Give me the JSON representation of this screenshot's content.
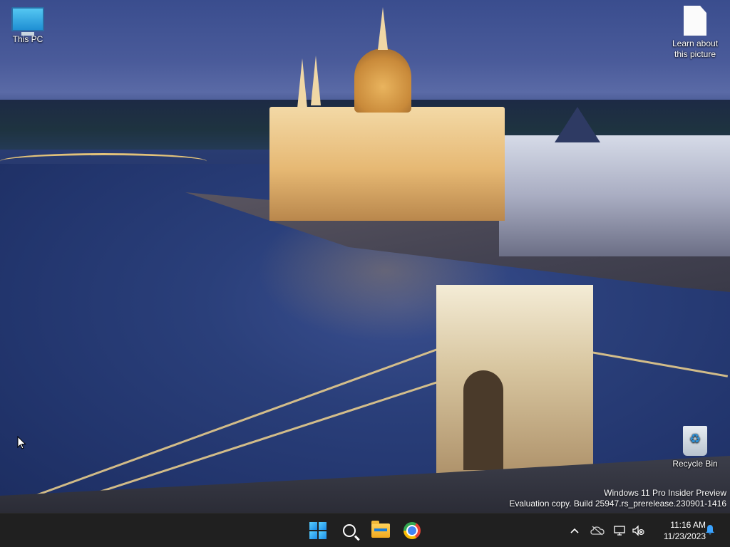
{
  "desktop": {
    "icons": [
      {
        "label": "This PC",
        "icon": "this-pc-icon"
      },
      {
        "label": "Learn about\nthis picture",
        "icon": "document-icon"
      },
      {
        "label": "Recycle Bin",
        "icon": "recycle-bin-icon"
      }
    ],
    "watermark": {
      "line1": "Windows 11 Pro Insider Preview",
      "line2": "Evaluation copy. Build 25947.rs_prerelease.230901-1416"
    }
  },
  "taskbar": {
    "apps": [
      {
        "name": "Start",
        "icon": "windows-start-icon"
      },
      {
        "name": "Search",
        "icon": "search-icon"
      },
      {
        "name": "File Explorer",
        "icon": "file-explorer-icon"
      },
      {
        "name": "Google Chrome",
        "icon": "chrome-icon"
      }
    ],
    "tray": {
      "overflow_glyph": "^",
      "time": "11:16 AM",
      "date": "11/23/2023"
    }
  },
  "colors": {
    "taskbar_bg": "#202020",
    "accent": "#3aa3ff"
  }
}
